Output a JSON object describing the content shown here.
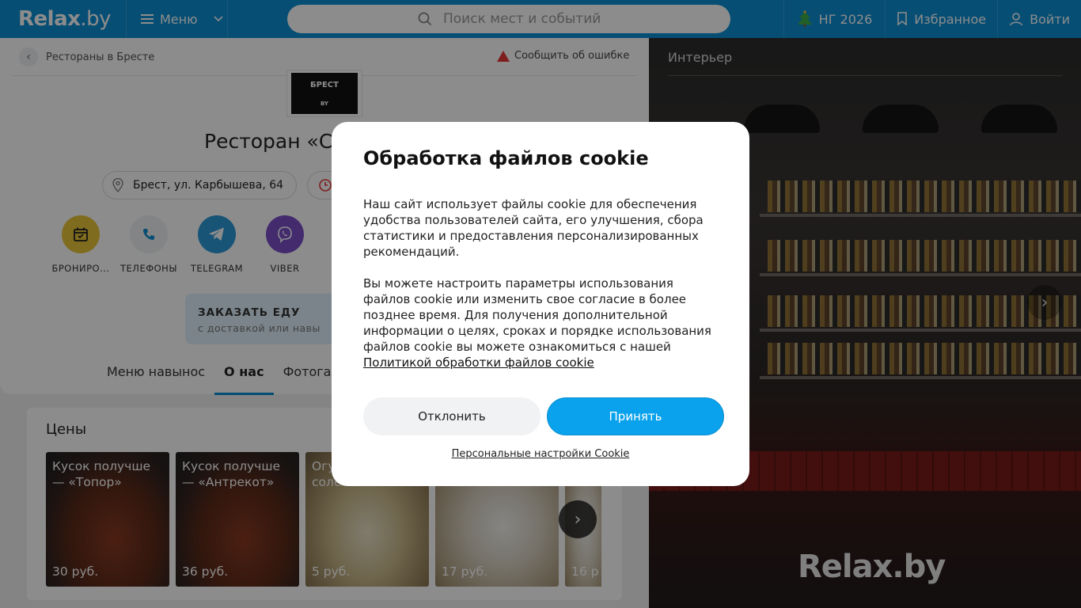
{
  "header": {
    "logo": "Relax",
    "logo_suffix": ".by",
    "menu_label": "Меню",
    "search_placeholder": "Поиск мест и событий",
    "ng_label": "НГ 2026",
    "favorites_label": "Избранное",
    "login_label": "Войти",
    "accent_color": "#0c8fd3"
  },
  "place": {
    "breadcrumb": "Рестораны в Бресте",
    "report_label": "Сообщить об ошибке",
    "logo_text_top": "БРЕСТ",
    "logo_text_bottom": "BY",
    "title": "Ресторан «Су",
    "address": "Брест, ул. Карбышева, 64",
    "actions": [
      {
        "label": "БРОНИРО...",
        "icon": "calendar-icon",
        "color": "#e8c53a"
      },
      {
        "label": "ТЕЛЕФОНЫ",
        "icon": "phone-icon",
        "color": "#eef0f2"
      },
      {
        "label": "TELEGRAM",
        "icon": "telegram-icon",
        "color": "#2a9ad8"
      },
      {
        "label": "VIBER",
        "icon": "viber-icon",
        "color": "#7b4fc9"
      }
    ],
    "order": {
      "title": "ЗАКАЗАТЬ ЕДУ",
      "subtitle": "с доставкой или навы"
    },
    "tabs": [
      "Меню навынос",
      "О нас",
      "Фотогале"
    ],
    "active_tab": "О нас"
  },
  "prices": {
    "title": "Цены",
    "items": [
      {
        "name": "Кусок получше — «Топор»",
        "price": "30 руб."
      },
      {
        "name": "Кусок получше — «Антрекот»",
        "price": "36 руб."
      },
      {
        "name": "Огу соле",
        "price": "5 руб."
      },
      {
        "name": "",
        "price": "17 руб."
      },
      {
        "name": "",
        "price": "16 р"
      }
    ]
  },
  "gallery": {
    "label": "Интерьер",
    "watermark": "Relax.by"
  },
  "cookie": {
    "title": "Обработка файлов cookie",
    "para1": "Наш сайт использует файлы cookie для обеспечения удобства пользователей сайта, его улучшения, сбора статистики и предоставления персонализированных рекомендаций.",
    "para2": "Вы можете настроить параметры использования файлов cookie или изменить свое согласие в более позднее время. Для получения дополнительной информации о целях, сроках и порядке использования файлов cookie вы можете ознакомиться с нашей",
    "policy_link": "Политикой обработки файлов cookie",
    "decline": "Отклонить",
    "accept": "Принять",
    "personal": "Персональные настройки Cookie"
  }
}
